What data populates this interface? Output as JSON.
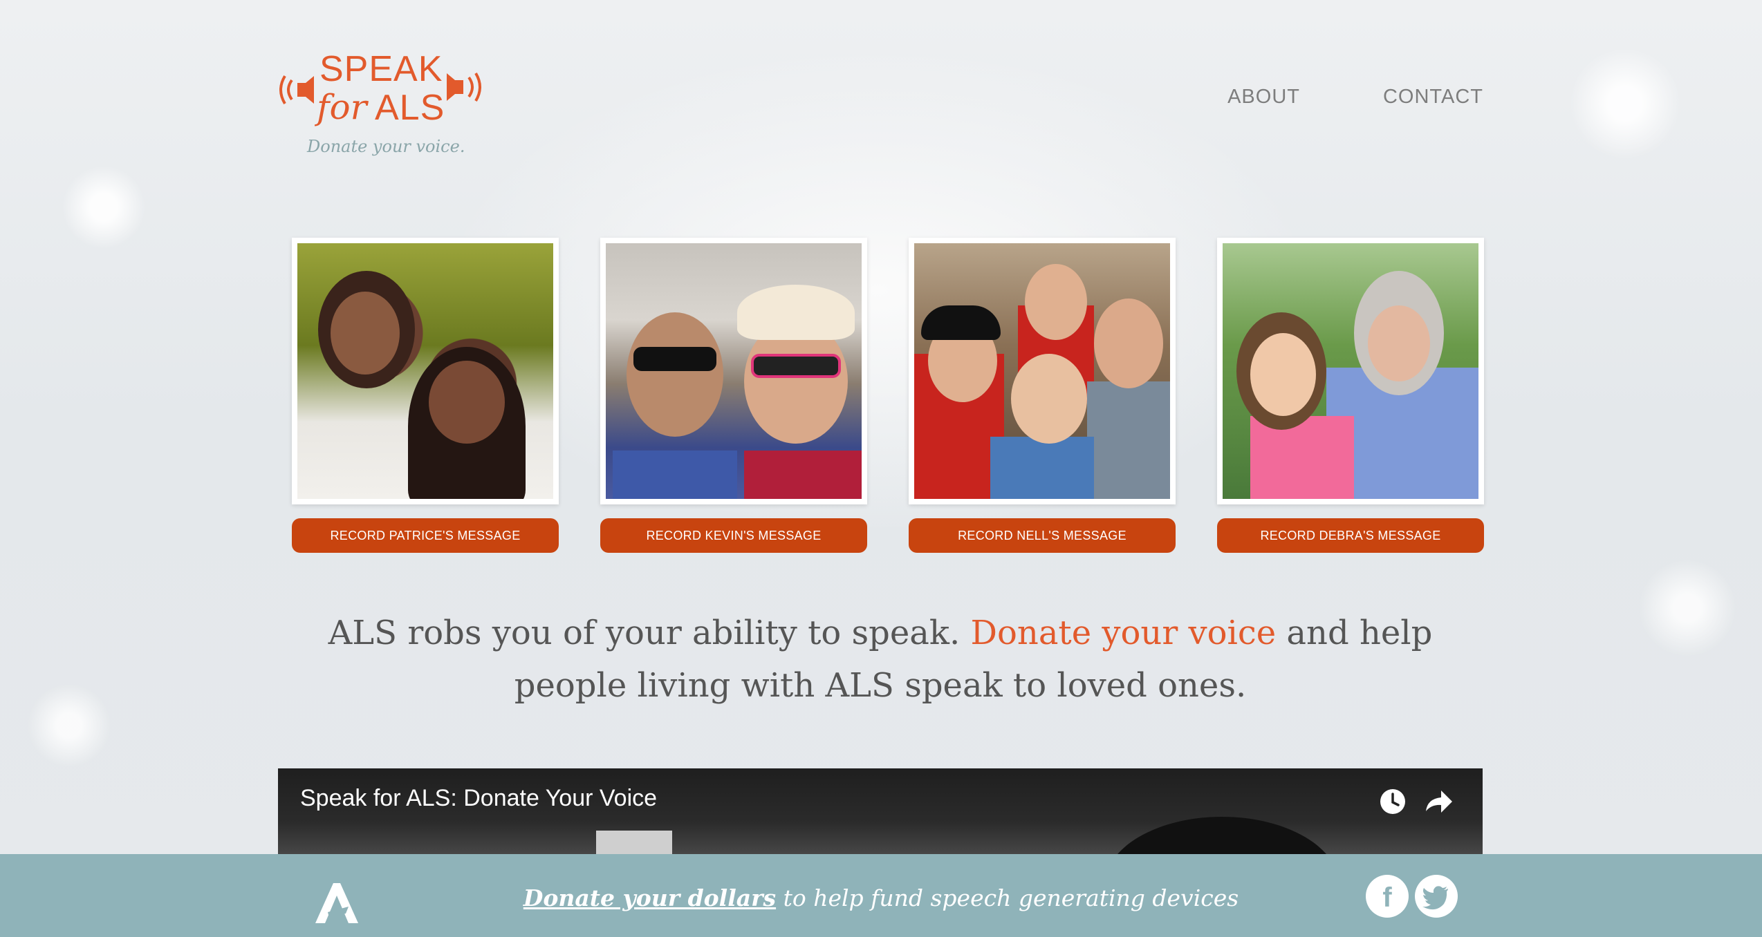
{
  "brand": {
    "logo_speak": "SPEAK",
    "logo_for": "for",
    "logo_als": "ALS",
    "tagline": "Donate your voice.",
    "accent_color": "#e25a2c"
  },
  "nav": {
    "about": "ABOUT",
    "contact": "CONTACT"
  },
  "cards": [
    {
      "button": "RECORD PATRICE'S MESSAGE"
    },
    {
      "button": "RECORD KEVIN'S MESSAGE"
    },
    {
      "button": "RECORD NELL'S MESSAGE"
    },
    {
      "button": "RECORD DEBRA'S MESSAGE"
    }
  ],
  "tagline": {
    "part1": "ALS robs you of your ability to speak. ",
    "highlight": "Donate your voice",
    "part2": " and help people living with ALS speak to loved ones."
  },
  "video": {
    "title": "Speak for ALS: Donate Your Voice",
    "icons": [
      "clock-icon",
      "share-icon"
    ]
  },
  "footer": {
    "link_text": "Donate your dollars",
    "rest_text": " to help fund speech generating devices",
    "social": [
      "facebook-icon",
      "twitter-icon"
    ]
  }
}
